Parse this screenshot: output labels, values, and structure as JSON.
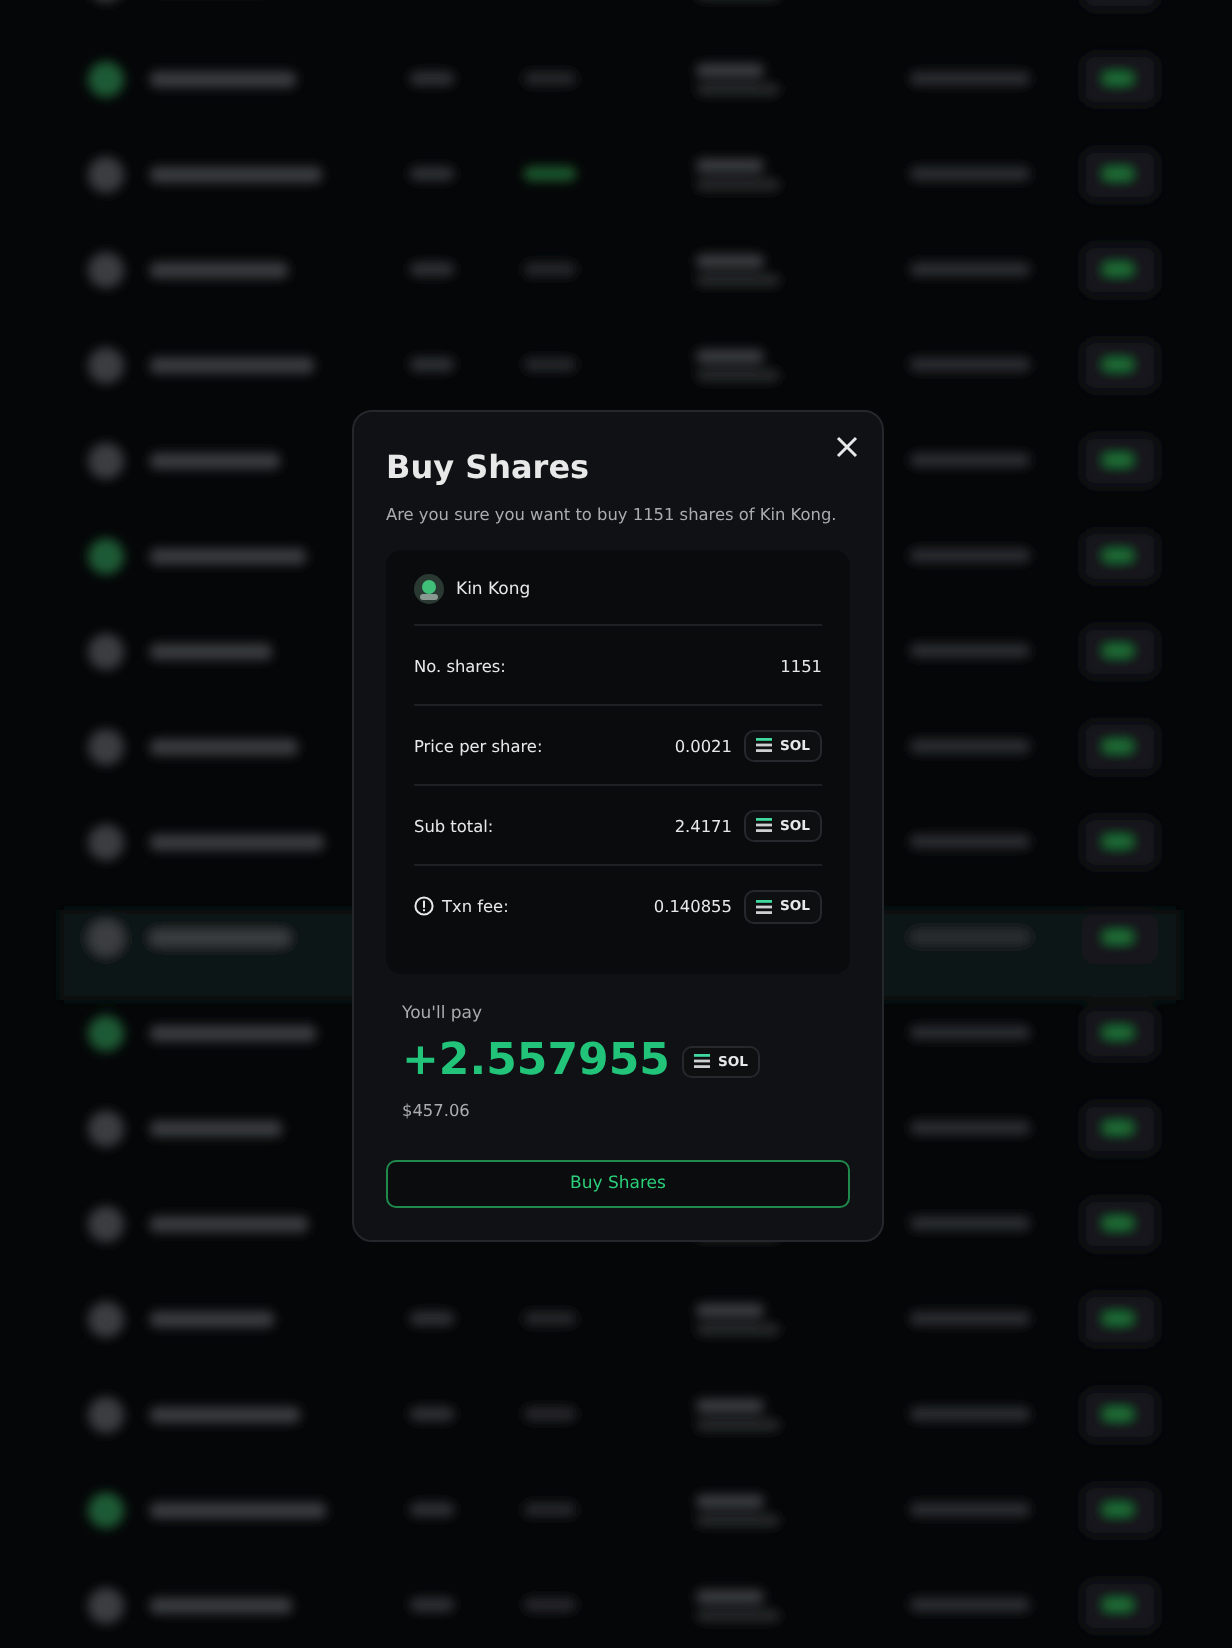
{
  "dialog": {
    "title": "Buy Shares",
    "message": "Are you sure you want to buy 1151 shares of Kin Kong.",
    "token": {
      "name": "Kin Kong"
    },
    "rows": [
      {
        "kind": "plain",
        "label": "No. shares:",
        "value": "1151"
      },
      {
        "kind": "currency",
        "label": "Price per share:",
        "value": "0.0021",
        "currency": "SOL"
      },
      {
        "kind": "currency",
        "label": "Sub total:",
        "value": "2.4171",
        "currency": "SOL"
      },
      {
        "kind": "fee",
        "label": "Txn fee:",
        "value": "0.140855",
        "currency": "SOL"
      }
    ],
    "total": {
      "label": "You'll pay",
      "amount": "+2.557955",
      "currency": "SOL",
      "usd": "$457.06"
    },
    "button": "Buy Shares"
  }
}
